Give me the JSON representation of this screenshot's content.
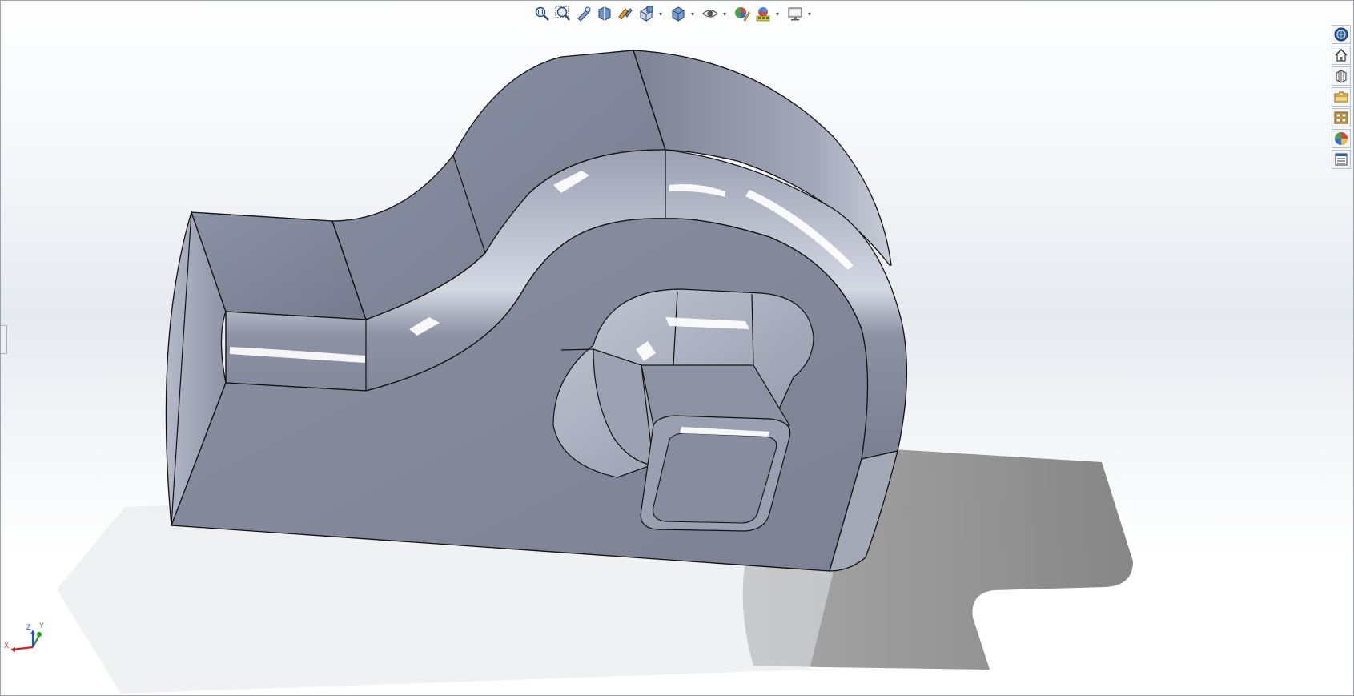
{
  "toolbar": {
    "items": [
      {
        "icon": "zoom-to-fit-icon"
      },
      {
        "icon": "zoom-to-area-icon"
      },
      {
        "icon": "previous-view-icon"
      },
      {
        "icon": "section-view-icon"
      },
      {
        "icon": "dynamic-annotation-views-icon"
      },
      {
        "icon": "view-orientation-icon"
      },
      {
        "icon": "display-style-icon"
      },
      {
        "icon": "hide-show-items-icon"
      },
      {
        "icon": "edit-appearance-icon"
      },
      {
        "icon": "apply-scene-icon"
      },
      {
        "icon": "view-settings-icon"
      }
    ],
    "caret": "▾"
  },
  "taskpane": {
    "items": [
      {
        "icon": "solidworks-resources-icon"
      },
      {
        "icon": "home-icon"
      },
      {
        "icon": "design-library-icon"
      },
      {
        "icon": "file-explorer-icon"
      },
      {
        "icon": "view-palette-icon"
      },
      {
        "icon": "appearances-scenes-icon"
      },
      {
        "icon": "custom-properties-icon"
      }
    ]
  },
  "triad": {
    "x_label": "X",
    "y_label": "Y",
    "z_label": "Z"
  },
  "colors": {
    "part_face": "#858b9d",
    "part_light": "#a8adbd",
    "part_dark": "#6f7586",
    "edge": "#111111",
    "shadow": "#8f8f8f",
    "x_axis": "#d42020",
    "y_axis": "#1fa01f",
    "z_axis": "#2050d0"
  }
}
